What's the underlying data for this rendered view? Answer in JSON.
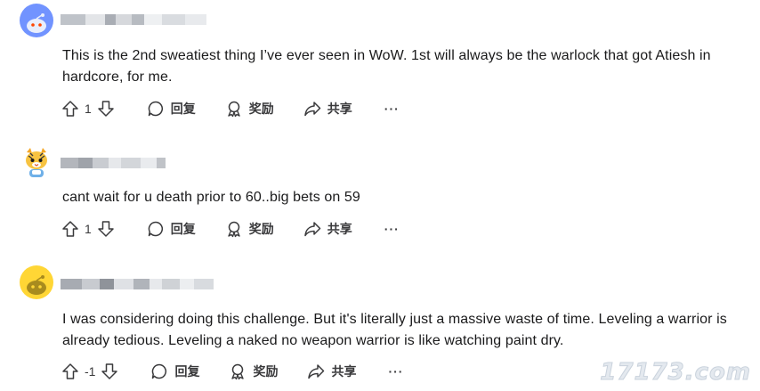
{
  "comments": [
    {
      "avatar_icon": "snoo-avatar-icon",
      "avatar_color": "#7193ff",
      "body": "This is the 2nd sweatiest thing I’ve ever seen in WoW. 1st will always be the warlock that got Atiesh in hardcore, for me.",
      "votes": "1",
      "reply_label": "回复",
      "award_label": "奖励",
      "share_label": "共享",
      "more_label": "···"
    },
    {
      "avatar_icon": "mascot-avatar-icon",
      "avatar_color": "#ffffff",
      "body": "cant wait for u death prior to 60..big bets on 59",
      "votes": "1",
      "reply_label": "回复",
      "award_label": "奖励",
      "share_label": "共享",
      "more_label": "···"
    },
    {
      "avatar_icon": "snoo-avatar-icon",
      "avatar_color": "#ffd635",
      "body": "I was considering doing this challenge. But it's literally just a massive waste of time. Leveling a warrior is already tedious. Leveling a naked no weapon warrior is like watching paint dry.",
      "votes": "-1",
      "reply_label": "回复",
      "award_label": "奖励",
      "share_label": "共享",
      "more_label": "···"
    }
  ],
  "watermark": "17173.com"
}
